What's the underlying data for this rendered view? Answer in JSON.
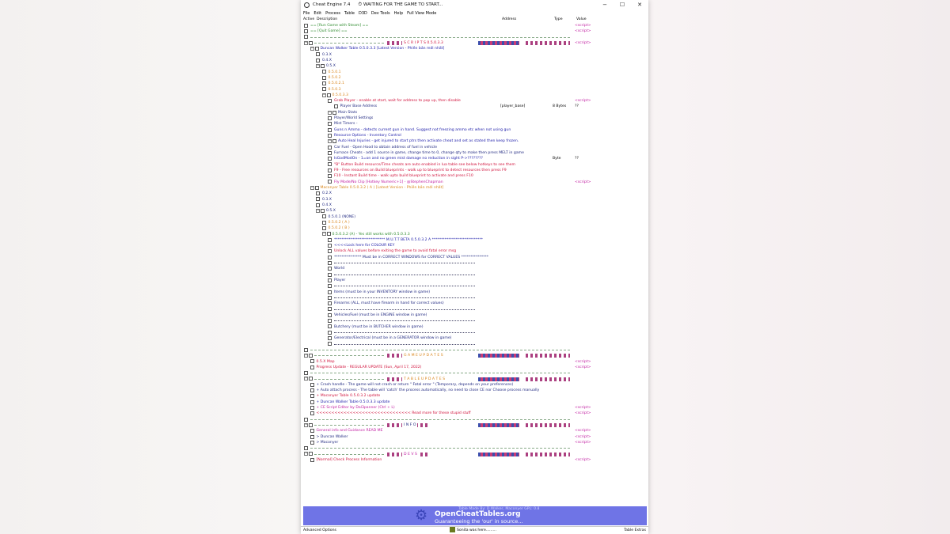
{
  "window": {
    "title": "Cheat Engine 7.4",
    "process_status": "WAITING FOR THE GAME TO START...",
    "controls": [
      "−",
      "☐",
      "✕"
    ]
  },
  "menu": [
    "File",
    "Edit",
    "Process",
    "Table",
    "D3D",
    "Dev Tools",
    "Help",
    "Full View Mode"
  ],
  "columns": {
    "active": "Active",
    "description": "Description",
    "address": "Address",
    "type": "Type",
    "value": "Value"
  },
  "colors": {
    "green": "#2e8b2e",
    "blue": "#1a1aa8",
    "navy": "#202880",
    "red": "#d0103a",
    "orange": "#d9851a",
    "magenta": "#c01aa0",
    "olive": "#7a7a20",
    "script": "#c01aa0"
  },
  "rows": [
    {
      "d": 0,
      "t": "cb",
      "text": "== [Run Game with Steam] ==",
      "c": "green",
      "v": "<script>"
    },
    {
      "d": 0,
      "t": "cb",
      "text": "== [Quit Game] ==",
      "c": "green",
      "v": "<script>"
    },
    {
      "d": 0,
      "t": "cb",
      "text": "",
      "sep": "plain"
    },
    {
      "d": 0,
      "t": "grp",
      "text": "S C R I P T S   0.5.0.3.3",
      "c": "red",
      "sep": "title",
      "v": "<script>"
    },
    {
      "d": 1,
      "t": "grp",
      "text": "Duncan Walker Table        0.5.0.3.3              [Latest Version - Phiên bản mới nhất]",
      "c": "blue"
    },
    {
      "d": 2,
      "t": "cb",
      "text": "0.3.X",
      "c": "navy"
    },
    {
      "d": 2,
      "t": "cb",
      "text": "0.4.X",
      "c": "navy"
    },
    {
      "d": 2,
      "t": "grp",
      "text": "0.5.X",
      "c": "navy"
    },
    {
      "d": 3,
      "t": "cb",
      "text": "0.5.0.1",
      "c": "orange"
    },
    {
      "d": 3,
      "t": "cb",
      "text": "0.5.0.2",
      "c": "orange"
    },
    {
      "d": 3,
      "t": "cb",
      "text": "0.5.0.2.1",
      "c": "orange"
    },
    {
      "d": 3,
      "t": "cb",
      "text": "0.5.0.3",
      "c": "orange"
    },
    {
      "d": 3,
      "t": "grp",
      "text": "0.5.0.3.3",
      "c": "orange"
    },
    {
      "d": 4,
      "t": "cb",
      "text": "Grab Player - enable at start, wait for address to pop up, then disable",
      "c": "red",
      "v": "<script>"
    },
    {
      "d": 5,
      "t": "cb",
      "text": "Player Base Address",
      "c": "navy",
      "a": "[player_base]",
      "ty": "8 Bytes",
      "v": "??"
    },
    {
      "d": 4,
      "t": "grp",
      "text": "Main Stats",
      "c": "navy"
    },
    {
      "d": 4,
      "t": "cb",
      "text": "Player/World Settings",
      "c": "navy"
    },
    {
      "d": 4,
      "t": "cb",
      "text": "Mist Timers -",
      "c": "navy"
    },
    {
      "d": 4,
      "t": "cb",
      "text": "Guns n Ammo - detects current gun in hand.  Suggest not freezing ammo etc when not using gun",
      "c": "blue"
    },
    {
      "d": 4,
      "t": "cb",
      "text": "Resource Options - Inventory Control",
      "c": "blue"
    },
    {
      "d": 4,
      "t": "grp",
      "text": "Auto Heal Injuries - get injured to start ptrs then activate cheat and set as stated then keep frozen.",
      "c": "blue"
    },
    {
      "d": 4,
      "t": "cb",
      "text": "Car Fuel - Open Hood to obtain address of fuel in vehicle",
      "c": "navy"
    },
    {
      "d": 4,
      "t": "cb",
      "text": "Furnace Cheats - add 1 source in game, change time to 0, change qty to make then press MELT in game",
      "c": "navy"
    },
    {
      "d": 4,
      "t": "cb",
      "text": "IsGodModOn - 1=on and no green mist damage no reduction in sight                    P->????????",
      "c": "blue",
      "ty": "Byte",
      "v": "??"
    },
    {
      "d": 4,
      "t": "cb",
      "text": "\"B\" Button Build resource/Time cheats are auto enabled in lua table see below hotkeys to see them",
      "c": "red"
    },
    {
      "d": 4,
      "t": "cb",
      "text": "F9 - Free resources on Build blueprints - walk up to blueprint to detect resources then press F9",
      "c": "red"
    },
    {
      "d": 4,
      "t": "cb",
      "text": "F10 - Instant Build time - walk upto build blueprint to activate and press F10",
      "c": "red"
    },
    {
      "d": 4,
      "t": "cb",
      "text": "Fly Mode/No Clip [Hotkey Numeric+1] - @StephenChapman",
      "c": "magenta",
      "v": "<script>"
    },
    {
      "d": 1,
      "t": "grp",
      "text": "Maconyer Table            0.5.0.3.2 ( A )              [Latest Version - Phiên bản mới nhất]",
      "c": "orange"
    },
    {
      "d": 2,
      "t": "cb",
      "text": "0.2.X",
      "c": "navy"
    },
    {
      "d": 2,
      "t": "cb",
      "text": "0.3.X",
      "c": "navy"
    },
    {
      "d": 2,
      "t": "cb",
      "text": "0.4.X",
      "c": "navy"
    },
    {
      "d": 2,
      "t": "grp",
      "text": "0.5.X",
      "c": "navy"
    },
    {
      "d": 3,
      "t": "cb",
      "text": "0.5.0.1 (NONE)",
      "c": "navy"
    },
    {
      "d": 3,
      "t": "cb",
      "text": "0.5.0.2 ( A )",
      "c": "orange"
    },
    {
      "d": 3,
      "t": "cb",
      "text": "0.5.0.2 ( B )",
      "c": "orange"
    },
    {
      "d": 3,
      "t": "grp",
      "text": "0.5.0.3.2 (A) - Yes still works with 0.5.0.3.3",
      "c": "green"
    },
    {
      "d": 4,
      "t": "cb",
      "text": "****************************   M.U.T.T BETA 0.5.0.3.2 A  ****************************",
      "c": "blue"
    },
    {
      "d": 4,
      "t": "cb",
      "text": "<<<<Lock here for COLOUR KEY",
      "c": "blue"
    },
    {
      "d": 4,
      "t": "cb",
      "text": "Unlock ALL values before exiting the game to avoid fatal error msg",
      "c": "red"
    },
    {
      "d": 4,
      "t": "cb",
      "text": "***************  Must be in CORRECT WINDOWS for CORRECT VALUES ***************",
      "c": "navy"
    },
    {
      "d": 4,
      "t": "cb",
      "text": "",
      "sep": "star"
    },
    {
      "d": 4,
      "t": "cb",
      "text": "World",
      "c": "navy"
    },
    {
      "d": 4,
      "t": "cb",
      "text": "",
      "sep": "star"
    },
    {
      "d": 4,
      "t": "cb",
      "text": "Player",
      "c": "navy"
    },
    {
      "d": 4,
      "t": "cb",
      "text": "",
      "sep": "star"
    },
    {
      "d": 4,
      "t": "cb",
      "text": "Items           (must be in your INVENTORY window in game)",
      "c": "navy"
    },
    {
      "d": 4,
      "t": "cb",
      "text": "",
      "sep": "star"
    },
    {
      "d": 4,
      "t": "cb",
      "text": "Firearms      (ALL, must have firearm in hand for correct values)",
      "c": "navy"
    },
    {
      "d": 4,
      "t": "cb",
      "text": "",
      "sep": "star"
    },
    {
      "d": 4,
      "t": "cb",
      "text": "Vehicles/Fuel               (must be in ENGINE window in game)",
      "c": "navy"
    },
    {
      "d": 4,
      "t": "cb",
      "text": "",
      "sep": "star"
    },
    {
      "d": 4,
      "t": "cb",
      "text": "Butchery                    (must be in BUTCHER window in game)",
      "c": "navy"
    },
    {
      "d": 4,
      "t": "cb",
      "text": "",
      "sep": "star"
    },
    {
      "d": 4,
      "t": "cb",
      "text": "Generator/Electrical    (must be in a GENERATOR window in game)",
      "c": "navy"
    },
    {
      "d": 4,
      "t": "cb",
      "text": "",
      "sep": "star"
    },
    {
      "d": 0,
      "t": "cb",
      "text": "",
      "sep": "plain"
    },
    {
      "d": 0,
      "t": "grp",
      "text": "G A M E   U P D A T E S",
      "c": "orange",
      "sep": "title"
    },
    {
      "d": 1,
      "t": "cb",
      "text": "0.5.X Map",
      "c": "red",
      "v": "<script>"
    },
    {
      "d": 1,
      "t": "cb",
      "text": "Progress Update - REGULAR UPDATE (Sun, April 17, 2022)",
      "c": "red",
      "v": "<script>"
    },
    {
      "d": 0,
      "t": "cb",
      "text": "",
      "sep": "plain"
    },
    {
      "d": 0,
      "t": "grp",
      "text": "T A B L E   U P D A T E S",
      "c": "orange",
      "sep": "title"
    },
    {
      "d": 1,
      "t": "cb",
      "text": "+ Crash handle - The game will not crash or return \" Fatal error \" (Temporary, depends on your preferences)",
      "c": "navy"
    },
    {
      "d": 1,
      "t": "cb",
      "text": "+ Auto attach process - The table will 'catch' the process automatically, no need to close CE nor Choose process manually",
      "c": "navy"
    },
    {
      "d": 1,
      "t": "cb",
      "text": "+ Maconyer Table 0.5.0.3.2 update",
      "c": "red"
    },
    {
      "d": 1,
      "t": "cb",
      "text": "+ Duncan Walker Table 0.5.0.3.3 update",
      "c": "blue"
    },
    {
      "d": 1,
      "t": "cb",
      "text": "+ CE Script Editor by Dal3panner (Ctrl + L)",
      "c": "magenta",
      "v": "<script>"
    },
    {
      "d": 1,
      "t": "cb",
      "text": "<<<<<<<<<<<<<<<<<<<<<<<<<<<<<<< Read more for these stupid stuff",
      "c": "red",
      "v": "<script>"
    },
    {
      "d": 0,
      "t": "cb",
      "text": "",
      "sep": "plain"
    },
    {
      "d": 0,
      "t": "grp",
      "text": "I N F O",
      "c": "navy",
      "sep": "title"
    },
    {
      "d": 1,
      "t": "cb",
      "text": "General info and Guidance READ ME",
      "c": "magenta",
      "v": "<script>"
    },
    {
      "d": 1,
      "t": "cb",
      "text": "> Duncan Walker",
      "c": "navy",
      "v": "<script>"
    },
    {
      "d": 1,
      "t": "cb",
      "text": "> Maconyer",
      "c": "navy",
      "v": "<script>"
    },
    {
      "d": 0,
      "t": "cb",
      "text": "",
      "sep": "plain"
    },
    {
      "d": 0,
      "t": "grp",
      "text": "D E V S",
      "c": "magenta",
      "sep": "title"
    },
    {
      "d": 1,
      "t": "cb",
      "text": "[Normal] Check Process Information",
      "c": "red",
      "v": "<script>"
    }
  ],
  "banner": {
    "made_by": "Table Made By: D.Walker, Maconyer          GPL: 0.8",
    "site": "OpenCheatTables.org",
    "slogan": "Guaranteeing the 'our' in source..."
  },
  "status": {
    "left": "Advanced Options",
    "middle": "Sonita was here.........",
    "right": "Table Extras"
  }
}
